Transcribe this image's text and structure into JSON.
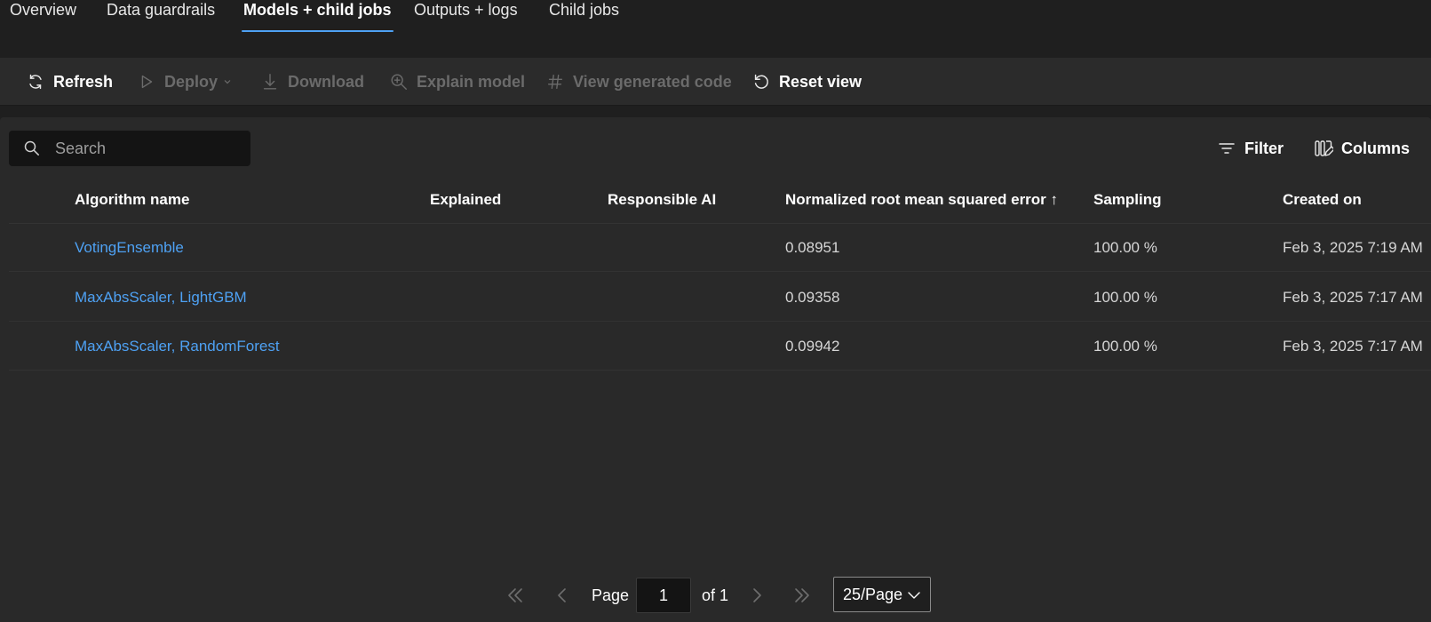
{
  "tabs": [
    {
      "label": "Overview"
    },
    {
      "label": "Data guardrails"
    },
    {
      "label": "Models + child jobs",
      "active": true
    },
    {
      "label": "Outputs + logs"
    },
    {
      "label": "Child jobs"
    }
  ],
  "toolbar": {
    "refresh": "Refresh",
    "deploy": "Deploy",
    "download": "Download",
    "explain": "Explain model",
    "view_code": "View generated code",
    "reset_view": "Reset view"
  },
  "search": {
    "placeholder": "Search"
  },
  "actions": {
    "filter": "Filter",
    "columns": "Columns"
  },
  "table": {
    "columns": [
      "Algorithm name",
      "Explained",
      "Responsible AI",
      "Normalized root mean squared error ↑",
      "Sampling",
      "Created on"
    ],
    "rows": [
      {
        "algorithm": "VotingEnsemble",
        "explained": "",
        "responsible_ai": "",
        "nrmse": "0.08951",
        "sampling": "100.00 %",
        "created_on": "Feb 3, 2025 7:19 AM"
      },
      {
        "algorithm": "MaxAbsScaler, LightGBM",
        "explained": "",
        "responsible_ai": "",
        "nrmse": "0.09358",
        "sampling": "100.00 %",
        "created_on": "Feb 3, 2025 7:17 AM"
      },
      {
        "algorithm": "MaxAbsScaler, RandomForest",
        "explained": "",
        "responsible_ai": "",
        "nrmse": "0.09942",
        "sampling": "100.00 %",
        "created_on": "Feb 3, 2025 7:17 AM"
      }
    ]
  },
  "pagination": {
    "page_label": "Page",
    "current_page": "1",
    "of_label": "of 1",
    "page_size": "25/Page"
  },
  "colors": {
    "accent": "#4ea1f3",
    "background": "#1f1f1f",
    "panel": "#292929",
    "disabled": "#6b6b6b"
  }
}
